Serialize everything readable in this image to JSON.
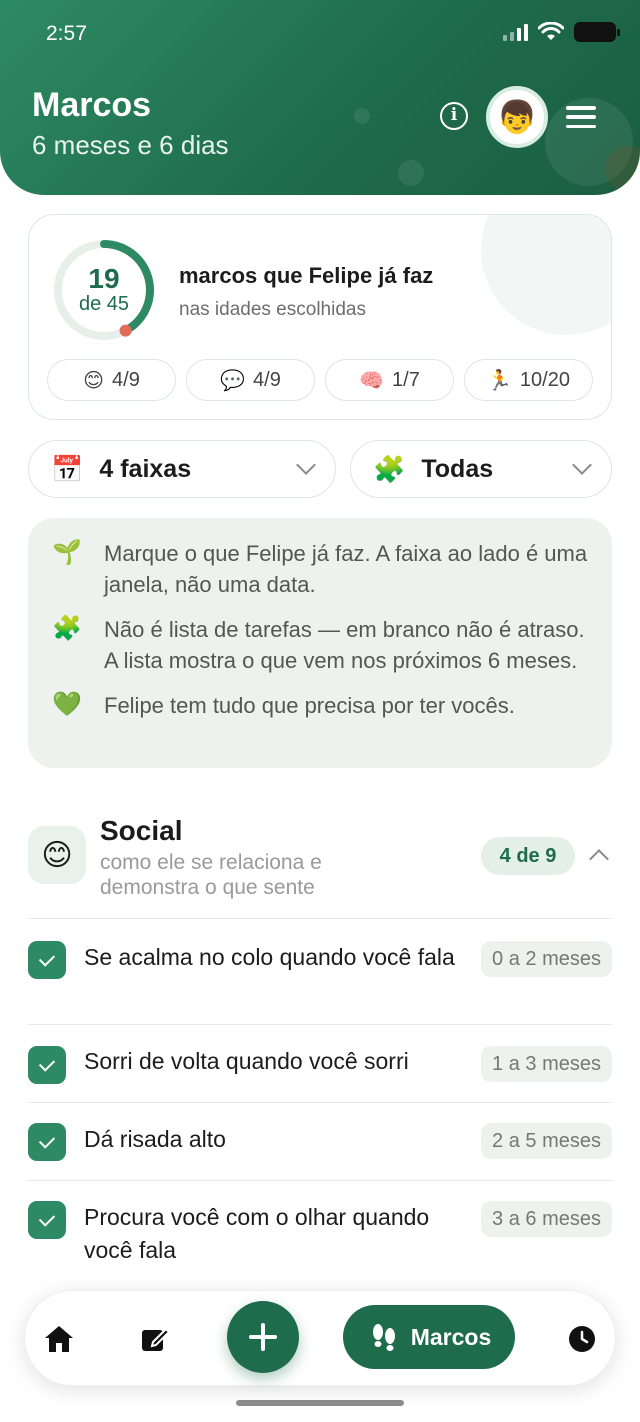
{
  "status_bar": {
    "time": "2:57"
  },
  "header": {
    "child_name": "Marcos",
    "age": "6 meses e 6 dias",
    "info_icon": "info-icon",
    "avatar_emoji": "👦",
    "menu_icon": "hamburger-menu-icon",
    "colors": {
      "primary": "#1f6c4c",
      "accent": "#2e8a64"
    }
  },
  "summary": {
    "done": "19",
    "total_label": "de 45",
    "progress_fraction": 0.4222,
    "title": "marcos que Felipe já faz",
    "subtitle": "nas idades escolhidas",
    "categories": [
      {
        "emoji": "😊",
        "value": "4/9"
      },
      {
        "emoji": "💬",
        "value": "4/9"
      },
      {
        "emoji": "🧠",
        "value": "1/7"
      },
      {
        "emoji": "🏃",
        "value": "10/20"
      }
    ]
  },
  "filters": {
    "age_range": {
      "emoji": "📅",
      "label": "4 faixas"
    },
    "category": {
      "emoji": "🧩",
      "label": "Todas"
    }
  },
  "tips": [
    {
      "emoji": "🌱",
      "text": "Marque o que Felipe já faz. A faixa ao lado é uma janela, não uma data."
    },
    {
      "emoji": "🧩",
      "text": "Não é lista de tarefas — em branco não é atraso. A lista mostra o que vem nos próximos 6 meses."
    },
    {
      "emoji": "💚",
      "text": "Felipe tem tudo que precisa por ter vocês."
    }
  ],
  "section": {
    "emoji": "😊",
    "title": "Social",
    "subtitle": "como ele se relaciona e demonstra o que sente",
    "badge": "4 de 9",
    "milestones": [
      {
        "text": "Se acalma no colo quando você fala",
        "age": "0 a 2 meses",
        "checked": true
      },
      {
        "text": "Sorri de volta quando você sorri",
        "age": "1 a 3 meses",
        "checked": true
      },
      {
        "text": "Dá risada alto",
        "age": "2 a 5 meses",
        "checked": true
      },
      {
        "text": "Procura você com o olhar quando você fala",
        "age": "3 a 6 meses",
        "checked": true
      }
    ]
  },
  "bottom_nav": {
    "active_label": "Marcos",
    "items": [
      "home-icon",
      "edit-icon",
      "add-icon",
      "footsteps-icon",
      "history-icon"
    ]
  }
}
